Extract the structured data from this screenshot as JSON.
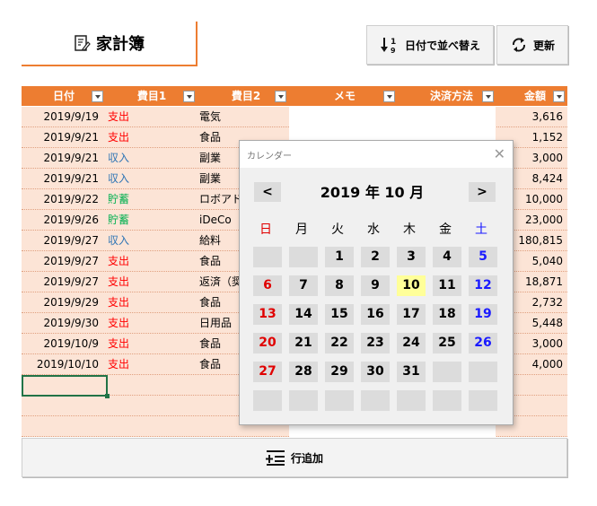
{
  "title": {
    "label": "家計簿"
  },
  "toolbar": {
    "sort_label": "日付で並べ替え",
    "refresh_label": "更新"
  },
  "add_row": {
    "label": "行追加"
  },
  "columns": [
    "日付",
    "費目1",
    "費目2",
    "メモ",
    "決済方法",
    "金額"
  ],
  "rows": [
    {
      "date": "2019/9/19",
      "cat1": "支出",
      "cat1_color": "#ff0000",
      "cat2": "電気",
      "amount": "3,616"
    },
    {
      "date": "2019/9/21",
      "cat1": "支出",
      "cat1_color": "#ff0000",
      "cat2": "食品",
      "amount": "1,152"
    },
    {
      "date": "2019/9/21",
      "cat1": "収入",
      "cat1_color": "#2f75b5",
      "cat2": "副業",
      "amount": "3,000"
    },
    {
      "date": "2019/9/21",
      "cat1": "収入",
      "cat1_color": "#2f75b5",
      "cat2": "副業",
      "amount": "8,424"
    },
    {
      "date": "2019/9/22",
      "cat1": "貯蓄",
      "cat1_color": "#00b050",
      "cat2": "ロボアド",
      "amount": "10,000"
    },
    {
      "date": "2019/9/26",
      "cat1": "貯蓄",
      "cat1_color": "#00b050",
      "cat2": "iDeCo",
      "amount": "23,000"
    },
    {
      "date": "2019/9/27",
      "cat1": "収入",
      "cat1_color": "#2f75b5",
      "cat2": "給料",
      "amount": "180,815"
    },
    {
      "date": "2019/9/27",
      "cat1": "支出",
      "cat1_color": "#ff0000",
      "cat2": "食品",
      "amount": "5,040"
    },
    {
      "date": "2019/9/27",
      "cat1": "支出",
      "cat1_color": "#ff0000",
      "cat2": "返済（奨",
      "amount": "18,871"
    },
    {
      "date": "2019/9/29",
      "cat1": "支出",
      "cat1_color": "#ff0000",
      "cat2": "食品",
      "amount": "2,732"
    },
    {
      "date": "2019/9/30",
      "cat1": "支出",
      "cat1_color": "#ff0000",
      "cat2": "日用品",
      "amount": "5,448"
    },
    {
      "date": "2019/10/9",
      "cat1": "支出",
      "cat1_color": "#ff0000",
      "cat2": "食品",
      "amount": "3,000"
    },
    {
      "date": "2019/10/10",
      "cat1": "支出",
      "cat1_color": "#ff0000",
      "cat2": "食品",
      "amount": "4,000"
    }
  ],
  "calendar": {
    "window_title": "カレンダー",
    "prev_label": "<",
    "next_label": ">",
    "month_label": "2019 年  10 月",
    "weekdays": [
      "日",
      "月",
      "火",
      "水",
      "木",
      "金",
      "土"
    ],
    "weeks": [
      [
        "",
        "",
        "1",
        "2",
        "3",
        "4",
        "5"
      ],
      [
        "6",
        "7",
        "8",
        "9",
        "10",
        "11",
        "12"
      ],
      [
        "13",
        "14",
        "15",
        "16",
        "17",
        "18",
        "19"
      ],
      [
        "20",
        "21",
        "22",
        "23",
        "24",
        "25",
        "26"
      ],
      [
        "27",
        "28",
        "29",
        "30",
        "31",
        "",
        ""
      ],
      [
        "",
        "",
        "",
        "",
        "",
        "",
        ""
      ]
    ],
    "today": "10",
    "colors": {
      "sunday": "#e00000",
      "saturday": "#1a1aff",
      "today_bg": "#ffff99",
      "header_bg": "#ed7d31"
    }
  }
}
